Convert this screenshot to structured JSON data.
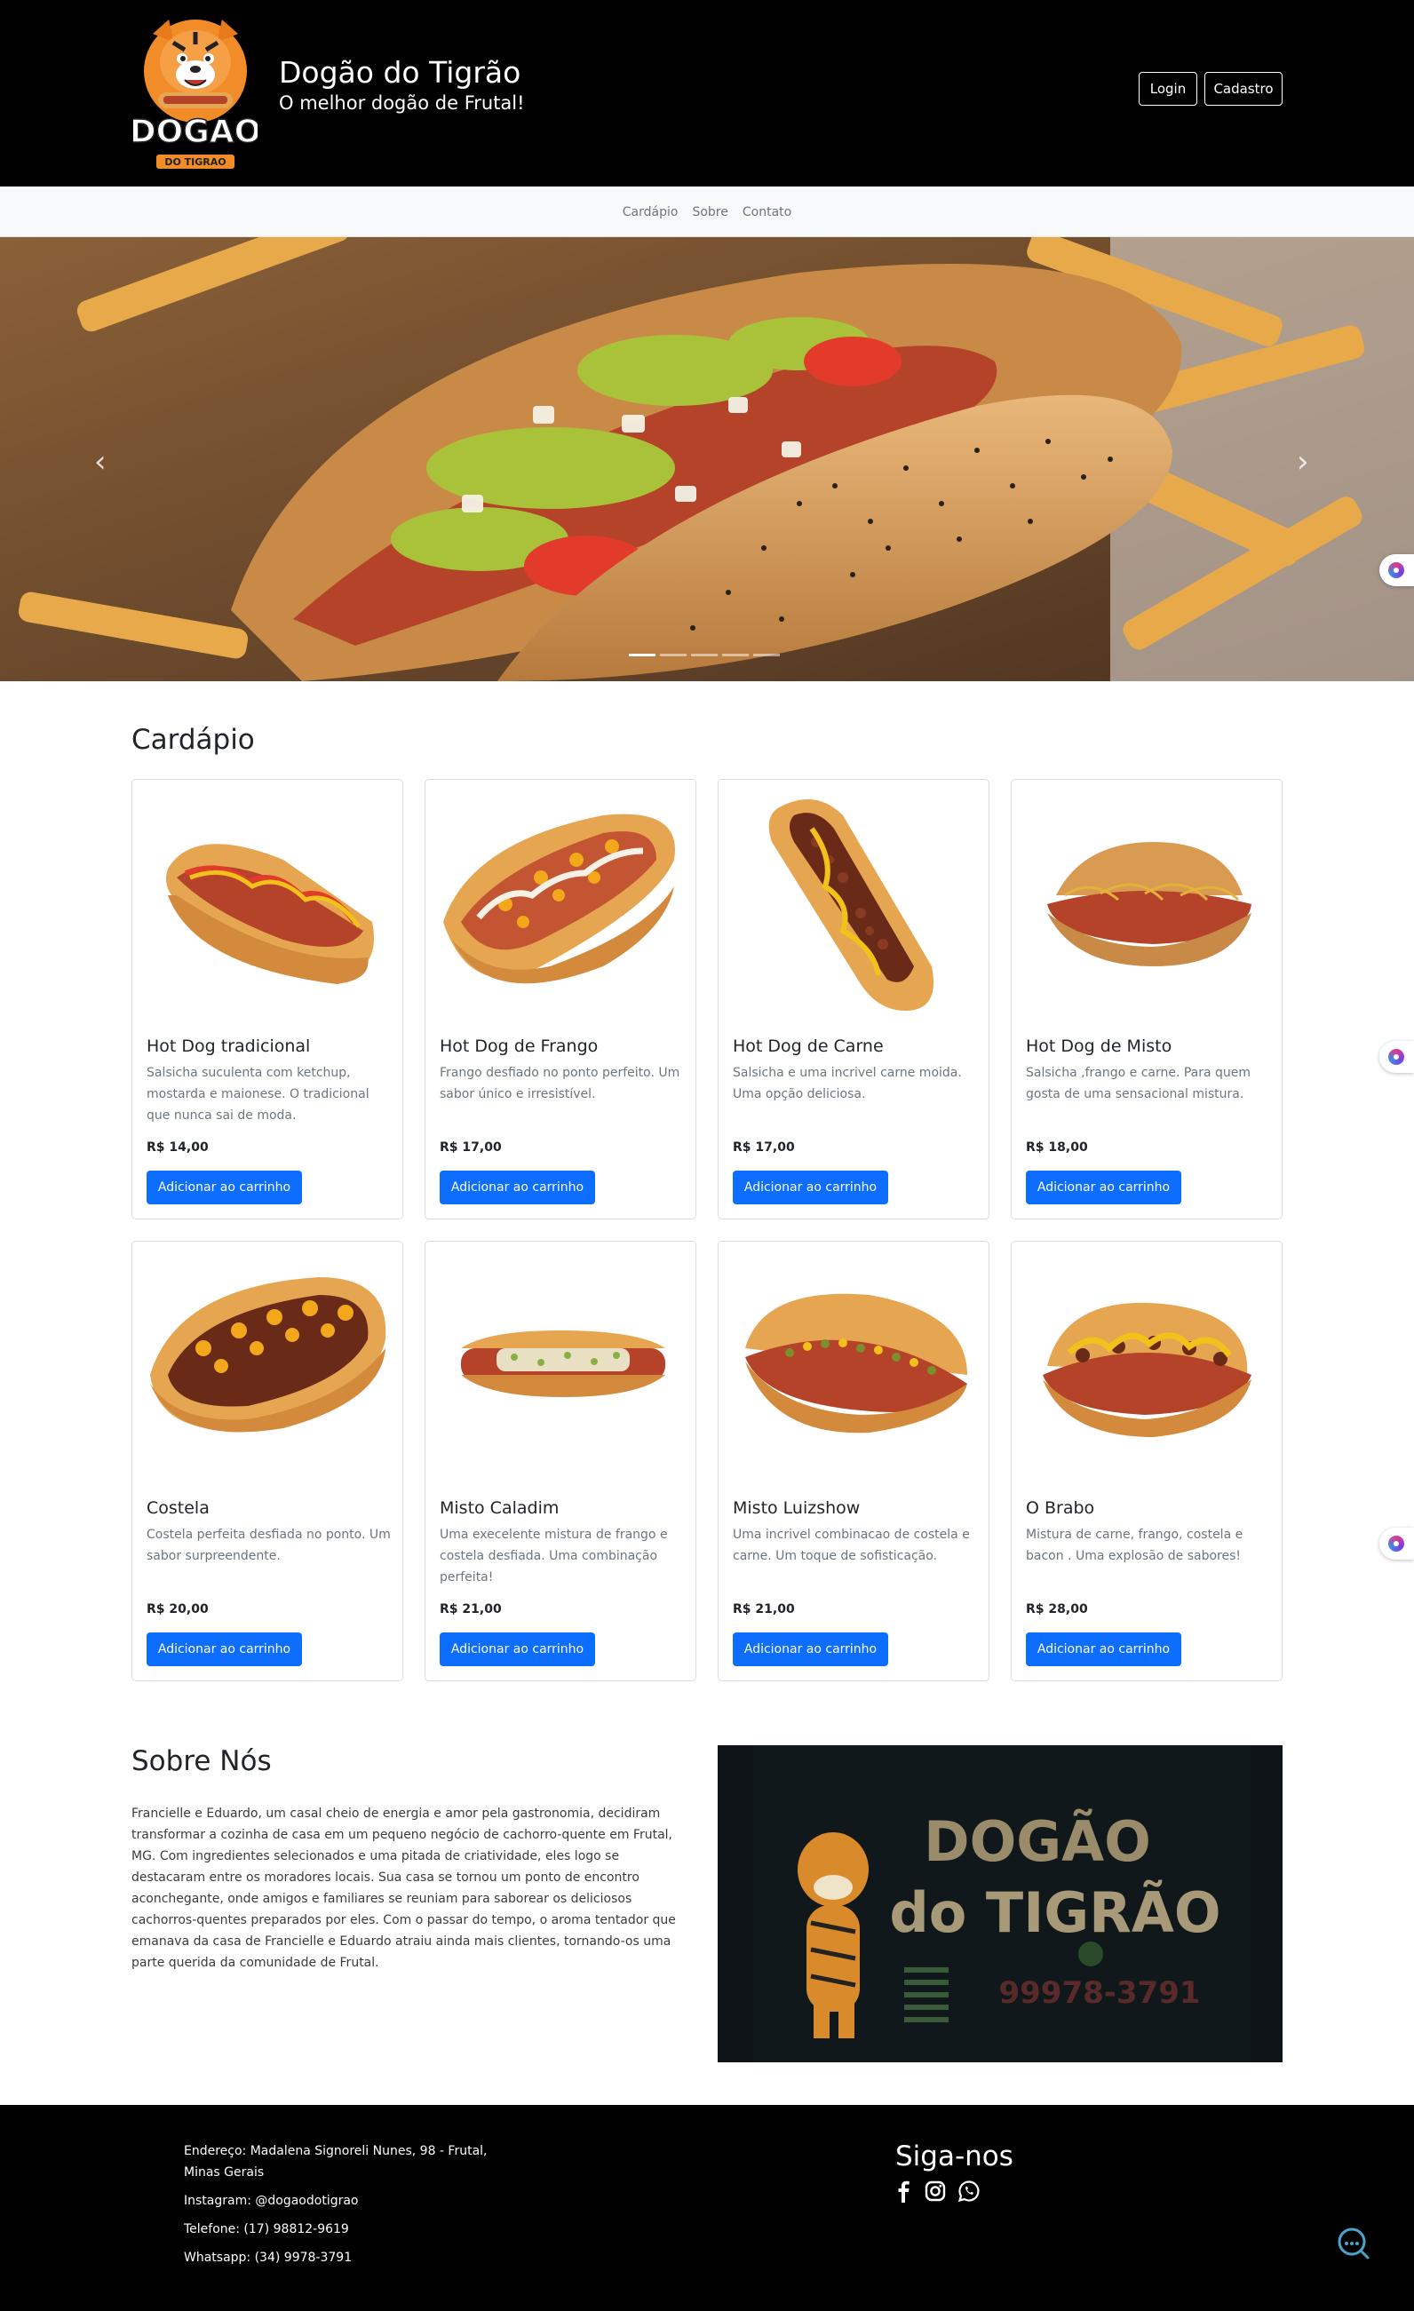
{
  "header": {
    "brand_title": "Dogão do Tigrão",
    "brand_subtitle": "O melhor dogão de Frutal!",
    "logo_text_main": "DOGAO",
    "logo_text_sub": "DO TIGRAO",
    "login_label": "Login",
    "cadastro_label": "Cadastro"
  },
  "nav": {
    "items": [
      {
        "label": "Cardápio"
      },
      {
        "label": "Sobre"
      },
      {
        "label": "Contato"
      }
    ]
  },
  "carousel": {
    "prev_icon": "chevron-left-icon",
    "next_icon": "chevron-right-icon",
    "slide_count": 5,
    "active_slide": 1
  },
  "cardapio": {
    "title": "Cardápio",
    "add_label": "Adicionar ao carrinho",
    "items": [
      {
        "name": "Hot Dog tradicional",
        "desc": "Salsicha suculenta com ketchup, mostarda e maionese. O tradicional que nunca sai de moda.",
        "price": "R$ 14,00"
      },
      {
        "name": "Hot Dog de Frango",
        "desc": "Frango desfiado no ponto perfeito. Um sabor único e irresistível.",
        "price": "R$ 17,00"
      },
      {
        "name": "Hot Dog de Carne",
        "desc": "Salsicha e uma incrivel carne moida. Uma opção deliciosa.",
        "price": "R$ 17,00"
      },
      {
        "name": "Hot Dog de Misto",
        "desc": "Salsicha ,frango e carne. Para quem gosta de uma sensacional mistura.",
        "price": "R$ 18,00"
      },
      {
        "name": "Costela",
        "desc": "Costela perfeita desfiada no ponto. Um sabor surpreendente.",
        "price": "R$ 20,00"
      },
      {
        "name": "Misto Caladim",
        "desc": "Uma execelente mistura de frango e costela desfiada. Uma combinação perfeita!",
        "price": "R$ 21,00"
      },
      {
        "name": "Misto Luizshow",
        "desc": "Uma incrivel combinacao de costela e carne. Um toque de sofisticação.",
        "price": "R$ 21,00"
      },
      {
        "name": "O Brabo",
        "desc": "Mistura de carne, frango, costela e bacon . Uma explosão de sabores!",
        "price": "R$ 28,00"
      }
    ]
  },
  "sobre": {
    "title": "Sobre Nós",
    "text": "Francielle e Eduardo, um casal cheio de energia e amor pela gastronomia, decidiram transformar a cozinha de casa em um pequeno negócio de cachorro-quente em Frutal, MG. Com ingredientes selecionados e uma pitada de criatividade, eles logo se destacaram entre os moradores locais. Sua casa se tornou um ponto de encontro aconchegante, onde amigos e familiares se reuniam para saborear os deliciosos cachorros-quentes preparados por eles. Com o passar do tempo, o aroma tentador que emanava da casa de Francielle e Eduardo atraiu ainda mais clientes, tornando-os uma parte querida da comunidade de Frutal.",
    "sign_line1": "DOGÃO",
    "sign_line2": "do TIGRÃO",
    "sign_phone": "99978-3791"
  },
  "footer": {
    "endereco": "Endereço: Madalena Signoreli Nunes, 98 - Frutal, Minas Gerais",
    "instagram": "Instagram: @dogaodotigrao",
    "telefone": "Telefone: (17) 98812-9619",
    "whatsapp": "Whatsapp: (34) 9978-3791",
    "siga": "Siga-nos",
    "social_icons": [
      "facebook-icon",
      "instagram-icon",
      "whatsapp-icon"
    ]
  },
  "colors": {
    "header_bg": "#000000",
    "primary_button": "#0d6efd",
    "nav_bg": "#f8f9fa"
  }
}
